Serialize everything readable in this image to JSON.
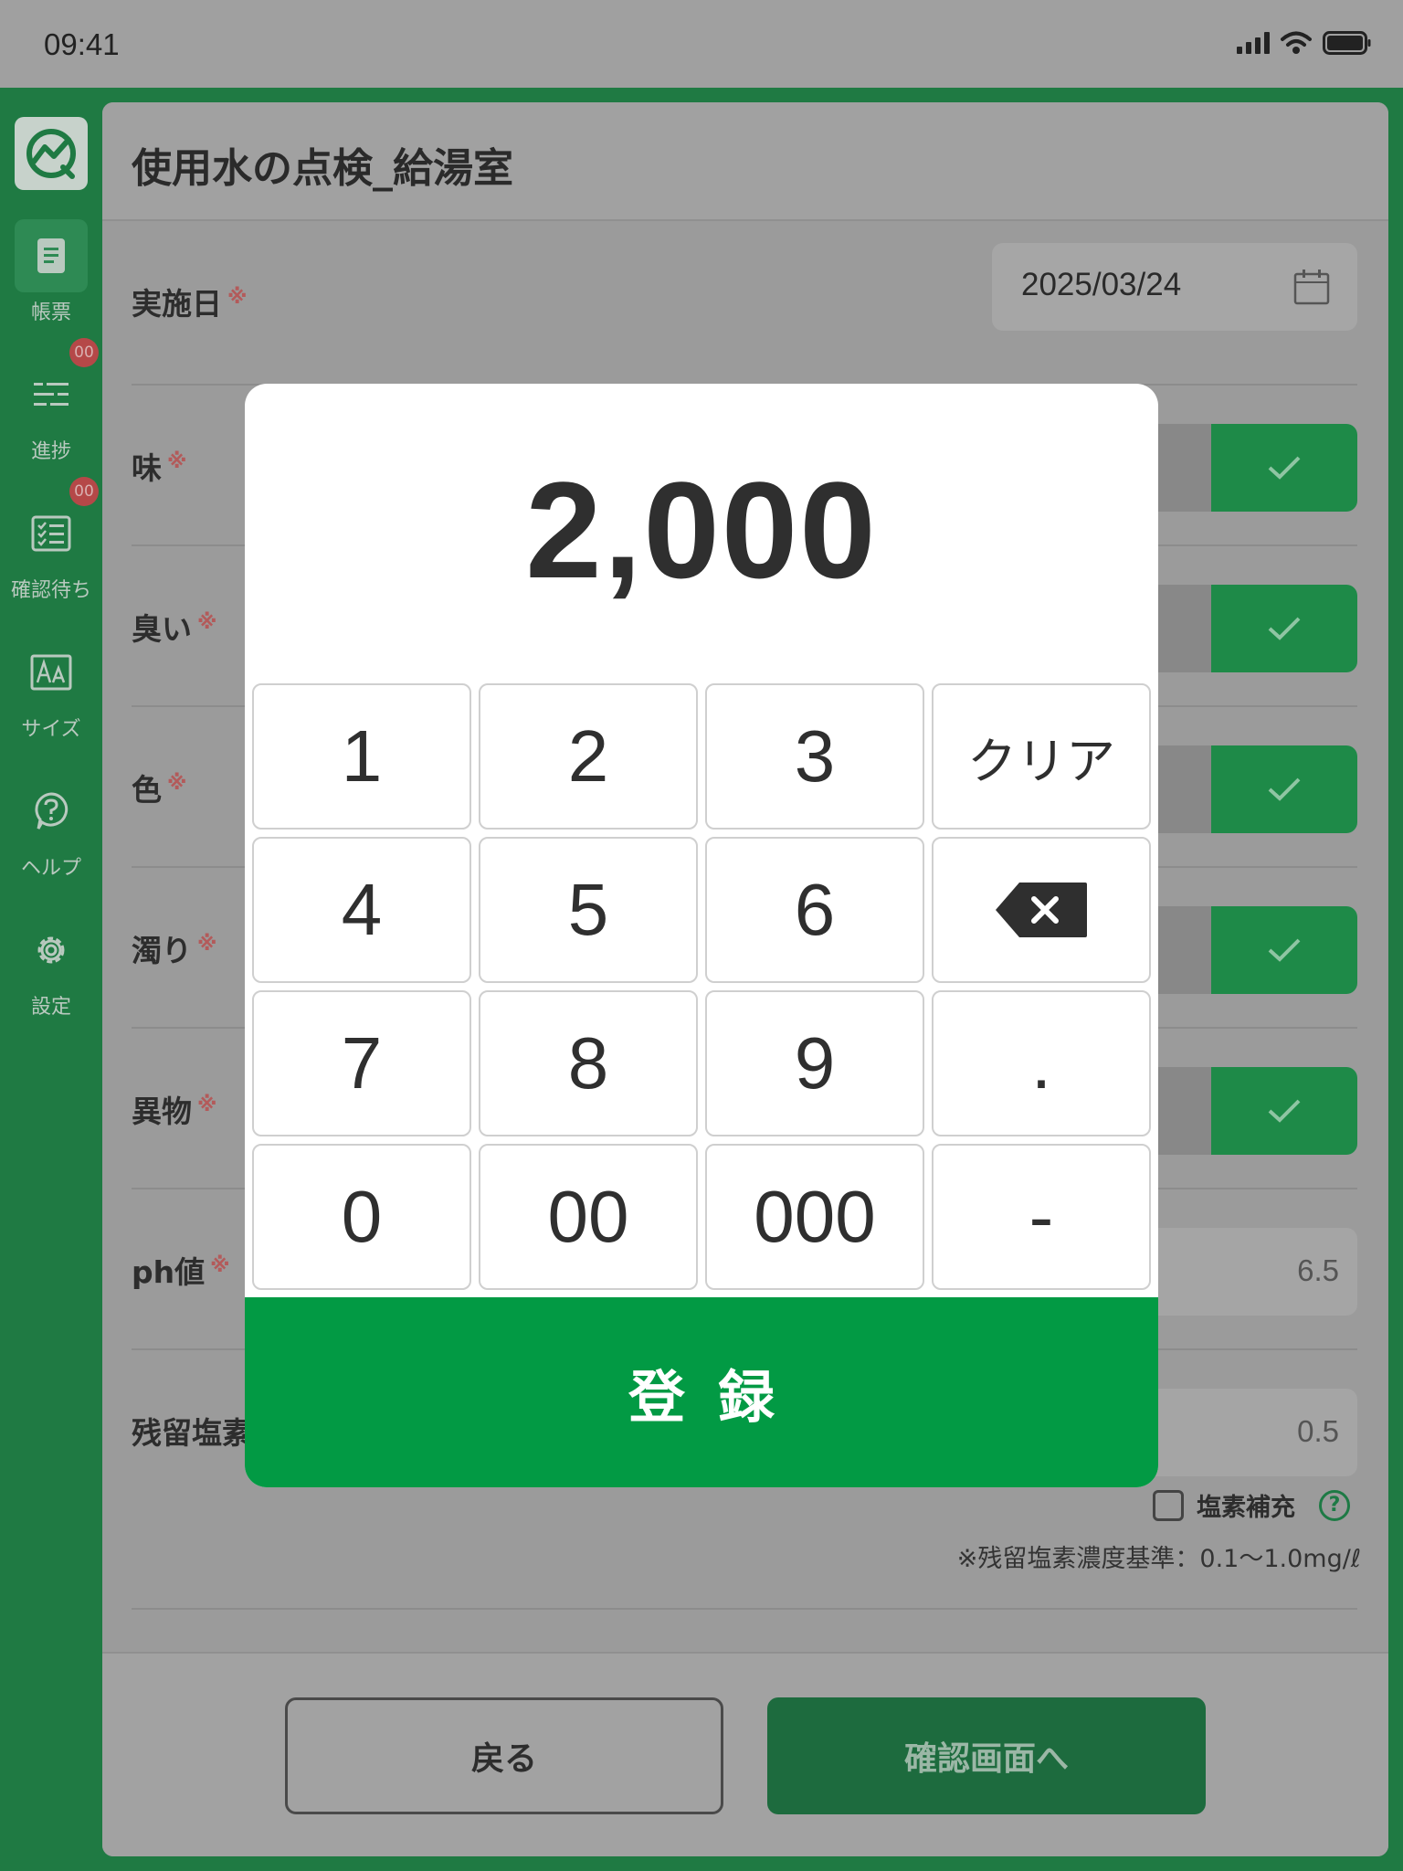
{
  "status_bar": {
    "time": "09:41"
  },
  "sidebar": {
    "items": [
      {
        "label": "帳票",
        "icon": "document-icon",
        "active": true,
        "badge": ""
      },
      {
        "label": "進捗",
        "icon": "progress-list-icon",
        "active": false,
        "badge": "00"
      },
      {
        "label": "確認待ち",
        "icon": "checklist-icon",
        "active": false,
        "badge": "00"
      },
      {
        "label": "サイズ",
        "icon": "font-size-icon",
        "active": false,
        "badge": ""
      },
      {
        "label": "ヘルプ",
        "icon": "help-icon",
        "active": false,
        "badge": ""
      },
      {
        "label": "設定",
        "icon": "gear-icon",
        "active": false,
        "badge": ""
      }
    ]
  },
  "page": {
    "title": "使用水の点検_給湯室"
  },
  "form": {
    "required_mark": "※",
    "date": {
      "label": "実施日",
      "value": "2025/03/24"
    },
    "taste": {
      "label": "味"
    },
    "smell": {
      "label": "臭い"
    },
    "color": {
      "label": "色"
    },
    "turbidity": {
      "label": "濁り"
    },
    "foreign_matter": {
      "label": "異物"
    },
    "ph": {
      "label": "ph値",
      "value": "6.5"
    },
    "residual_chlorine": {
      "label": "残留塩素",
      "value": "0.5"
    },
    "chlorine_refill": {
      "label": "塩素補充",
      "checked": false
    },
    "chlorine_note": "※残留塩素濃度基準：0.1〜1.0mg/ℓ",
    "help_mark": "?"
  },
  "footer": {
    "back_label": "戻る",
    "confirm_label": "確認画面へ"
  },
  "keypad": {
    "display": "2,000",
    "keys": {
      "k1": "1",
      "k2": "2",
      "k3": "3",
      "clear": "クリア",
      "k4": "4",
      "k5": "5",
      "k6": "6",
      "k7": "7",
      "k8": "8",
      "k9": "9",
      "dot": ".",
      "k0": "0",
      "k00": "00",
      "k000": "000",
      "minus": "-"
    },
    "submit_label": "登録"
  },
  "colors": {
    "accent_green": "#029a44",
    "sidebar_green": "#1f7a43",
    "badge_red": "#b54848"
  }
}
